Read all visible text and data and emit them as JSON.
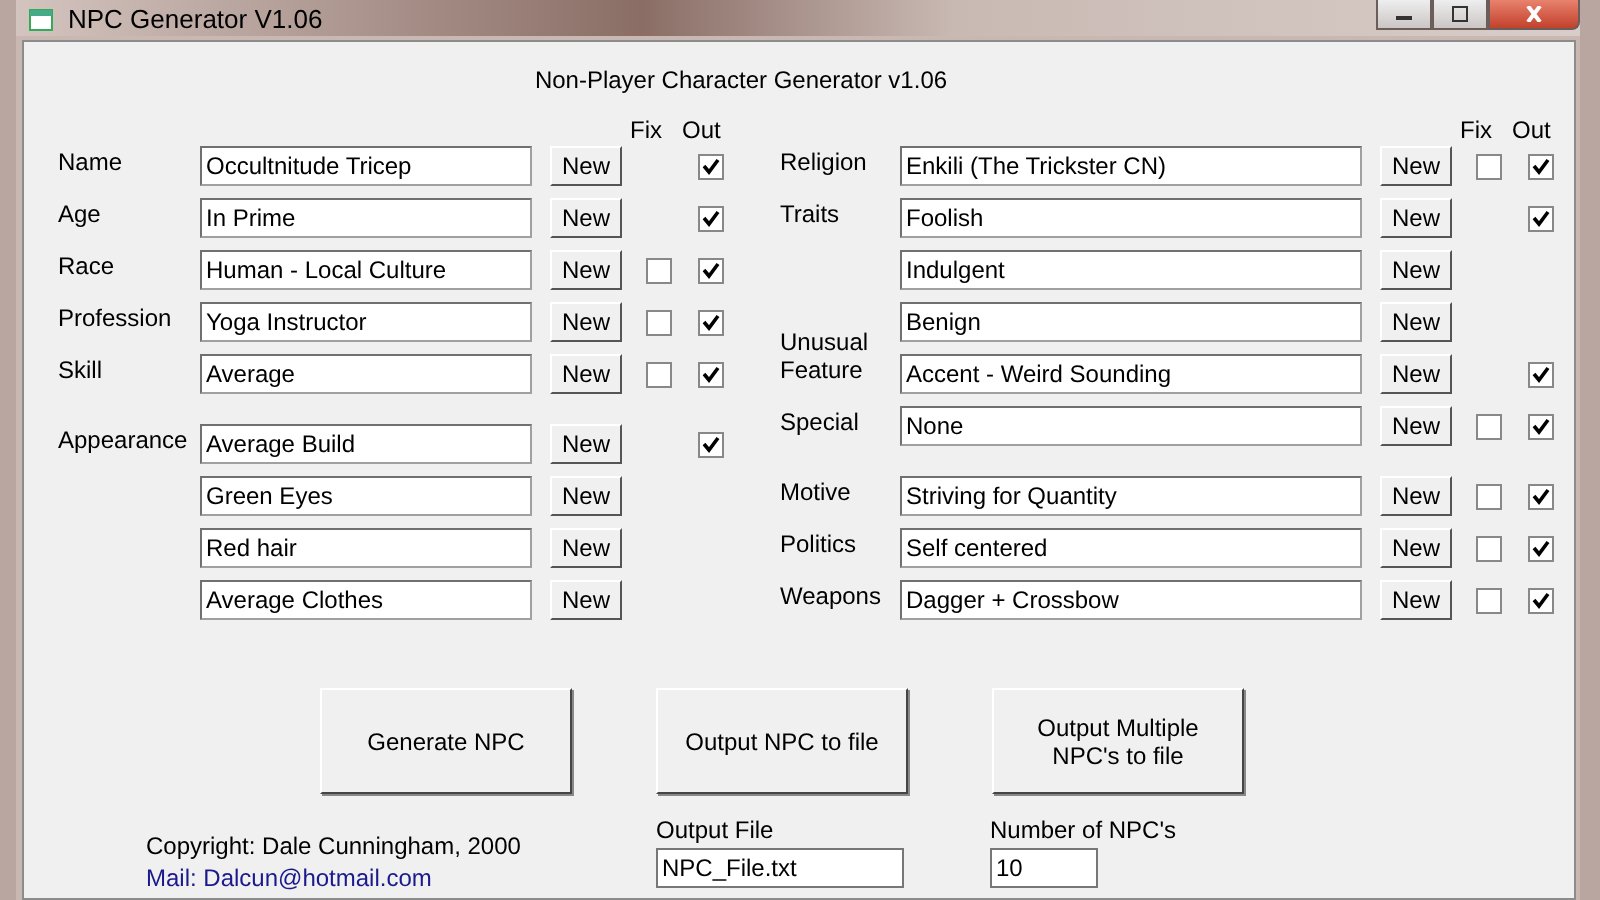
{
  "window": {
    "title": "NPC Generator V1.06"
  },
  "heading": "Non-Player Character Generator v1.06",
  "column_headers": [
    [
      "Fix",
      "Out"
    ],
    [
      "Fix",
      "Out"
    ]
  ],
  "columns": [
    [
      [
        {
          "label": "Name",
          "value": "Occultnitude Tricep",
          "button": "New",
          "out": true
        },
        {
          "label": "Age",
          "value": "In Prime",
          "button": "New",
          "out": true
        },
        {
          "label": "Race",
          "value": "Human - Local Culture",
          "button": "New",
          "fix": false,
          "out": true
        },
        {
          "label": "Profession",
          "value": "Yoga Instructor",
          "button": "New",
          "fix": false,
          "out": true
        },
        {
          "label": "Skill",
          "value": "Average",
          "button": "New",
          "fix": false,
          "out": true
        }
      ],
      [
        {
          "label": "Appearance",
          "value": "Average Build",
          "button": "New",
          "out": true
        },
        {
          "value": "Green Eyes",
          "button": "New"
        },
        {
          "value": "Red hair",
          "button": "New"
        },
        {
          "value": "Average Clothes",
          "button": "New"
        }
      ]
    ],
    [
      [
        {
          "label": "Religion",
          "value": "Enkili (The Trickster CN)",
          "button": "New",
          "fix": false,
          "out": true
        },
        {
          "label": "Traits",
          "value": "Foolish",
          "button": "New",
          "out": true
        },
        {
          "value": "Indulgent",
          "button": "New"
        },
        {
          "value": "Benign",
          "button": "New"
        },
        {
          "label": "Unusual Feature",
          "value": "Accent - Weird Sounding",
          "button": "New",
          "out": true
        },
        {
          "label": "Special",
          "value": "None",
          "button": "New",
          "fix": false,
          "out": true
        }
      ],
      [
        {
          "label": "Motive",
          "value": "Striving for Quantity",
          "button": "New",
          "fix": false,
          "out": true
        },
        {
          "label": "Politics",
          "value": "Self centered",
          "button": "New",
          "fix": false,
          "out": true
        },
        {
          "label": "Weapons",
          "value": "Dagger + Crossbow",
          "button": "New",
          "fix": false,
          "out": true
        }
      ]
    ]
  ],
  "actions": [
    "Generate NPC",
    "Output NPC to file",
    "Output Multiple NPC's to file"
  ],
  "copyright": "Copyright: Dale Cunningham, 2000",
  "mail": "Mail: Dalcun@hotmail.com",
  "output_file": {
    "label": "Output File",
    "value": "NPC_File.txt"
  },
  "npc_count": {
    "label": "Number of NPC's",
    "value": "10"
  }
}
